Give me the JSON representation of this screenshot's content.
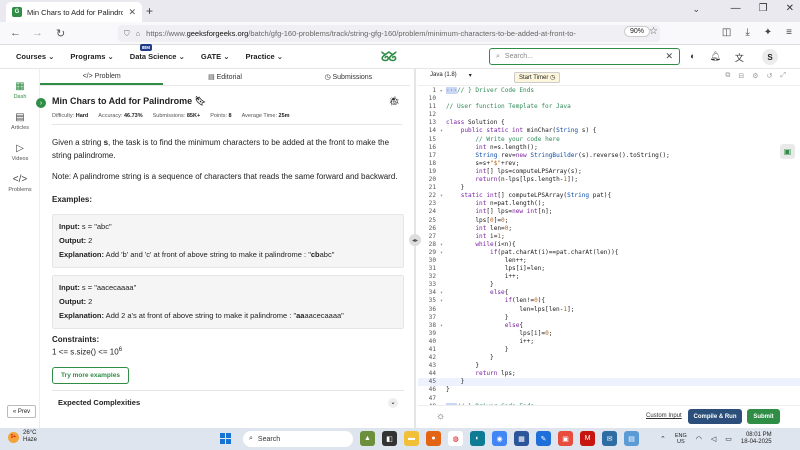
{
  "browser": {
    "tab_title": "Min Chars to Add for Palindron",
    "url_prefix": "https://www.",
    "url_host": "geeksforgeeks.org",
    "url_path": "/batch/gfg-160-problems/track/string-gfg-160/problem/minimum-characters-to-be-added-at-front-to-m",
    "zoom": "90%"
  },
  "header": {
    "menu": [
      {
        "label": "Courses"
      },
      {
        "label": "Programs"
      },
      {
        "label": "Data Science",
        "badge": "IBM"
      },
      {
        "label": "GATE"
      },
      {
        "label": "Practice"
      }
    ],
    "logo": "GG",
    "search_placeholder": "Search...",
    "avatar_letter": "S"
  },
  "rail": [
    {
      "label": "Dash",
      "icon": "dashboard-icon",
      "glyph": "▦",
      "active": true
    },
    {
      "label": "Articles",
      "icon": "articles-icon",
      "glyph": "▤",
      "active": false
    },
    {
      "label": "Videos",
      "icon": "videos-icon",
      "glyph": "▷",
      "active": false
    },
    {
      "label": "Problems",
      "icon": "code-icon",
      "glyph": "</>",
      "active": false
    }
  ],
  "prev_label": "« Prev",
  "problem_tabs": [
    {
      "label": "</> Problem",
      "active": true
    },
    {
      "label": "▤ Editorial",
      "active": false
    },
    {
      "label": "◷ Submissions",
      "active": false
    }
  ],
  "problem": {
    "title": "Min Chars to Add for Palindrome",
    "meta": [
      {
        "k": "Difficulty:",
        "v": "Hard"
      },
      {
        "k": "Accuracy:",
        "v": "46.73%"
      },
      {
        "k": "Submissions:",
        "v": "85K+"
      },
      {
        "k": "Points:",
        "v": "8"
      },
      {
        "k": "Average Time:",
        "v": "25m"
      }
    ],
    "desc_1": "Given a string ",
    "desc_s": "s",
    "desc_2": ", the task is to find the minimum characters to be added at the front to make the string palindrome.",
    "note": "Note: A palindrome string is a sequence of characters that reads the same forward and backward.",
    "examples_heading": "Examples:",
    "examples": [
      {
        "input": " s = \"abc\"",
        "output": " 2",
        "expl_pre": " Add 'b' and 'c' at front of above string to make it palindrome : \"",
        "expl_bold": "cb",
        "expl_post": "abc\""
      },
      {
        "input": " s = \"aacecaaaa\"",
        "output": " 2",
        "expl_pre": " Add 2 a's at front of above string to make it palindrome : \"",
        "expl_bold": "aa",
        "expl_post": "aacecaaaa\""
      }
    ],
    "input_label": "Input:",
    "output_label": "Output:",
    "expl_label": "Explanation:",
    "constraints_heading": "Constraints:",
    "constraint_base": "1 <= s.size() <= 10",
    "constraint_exp": "6",
    "more_examples": "Try more examples",
    "expected_complexities": "Expected Complexities"
  },
  "editor": {
    "language": "Java (1.8)",
    "timer": "Start Timer ◷",
    "lines": [
      {
        "n": "1",
        "g": "▸",
        "html": "<span class='fold'>···</span><span class='cm'>// } Driver Code Ends</span>"
      },
      {
        "n": "10",
        "g": "",
        "html": ""
      },
      {
        "n": "11",
        "g": "",
        "html": "<span class='cm'>// User function Template for Java</span>"
      },
      {
        "n": "12",
        "g": "",
        "html": ""
      },
      {
        "n": "13",
        "g": "",
        "html": "<span class='kw'>class</span> Solution {"
      },
      {
        "n": "14",
        "g": "▾",
        "html": "    <span class='kw'>public static int</span> minChar(<span class='ty'>String</span> s) {"
      },
      {
        "n": "15",
        "g": "",
        "html": "        <span class='cm'>// Write your code here</span>"
      },
      {
        "n": "16",
        "g": "",
        "html": "        <span class='kw'>int</span> n=s.length();"
      },
      {
        "n": "17",
        "g": "",
        "html": "        <span class='ty'>String</span> rev=<span class='kw'>new</span> <span class='ty'>StringBuilder</span>(s).reverse().toString();"
      },
      {
        "n": "18",
        "g": "",
        "html": "        s=s+<span class='num-c'>\"$\"</span>+rev;"
      },
      {
        "n": "19",
        "g": "",
        "html": "        <span class='kw'>int</span>[] lps=computeLPSArray(s);"
      },
      {
        "n": "20",
        "g": "",
        "html": "        <span class='kw'>return</span>(n-lps[lps.length-<span class='num-c'>1</span>]);"
      },
      {
        "n": "21",
        "g": "",
        "html": "    }"
      },
      {
        "n": "22",
        "g": "▾",
        "html": "    <span class='kw'>static int</span>[] computeLPSArray(<span class='ty'>String</span> pat){"
      },
      {
        "n": "23",
        "g": "",
        "html": "        <span class='kw'>int</span> n=pat.length();"
      },
      {
        "n": "24",
        "g": "",
        "html": "        <span class='kw'>int</span>[] lps=<span class='kw'>new int</span>[n];"
      },
      {
        "n": "25",
        "g": "",
        "html": "        lps[<span class='num-c'>0</span>]=<span class='num-c'>0</span>;"
      },
      {
        "n": "26",
        "g": "",
        "html": "        <span class='kw'>int</span> len=<span class='num-c'>0</span>;"
      },
      {
        "n": "27",
        "g": "",
        "html": "        <span class='kw'>int</span> i=<span class='num-c'>1</span>;"
      },
      {
        "n": "28",
        "g": "▾",
        "html": "        <span class='kw'>while</span>(i&lt;n){"
      },
      {
        "n": "29",
        "g": "▾",
        "html": "            <span class='kw'>if</span>(pat.charAt(i)==pat.charAt(len)){"
      },
      {
        "n": "30",
        "g": "",
        "html": "                len++;"
      },
      {
        "n": "31",
        "g": "",
        "html": "                lps[i]=len;"
      },
      {
        "n": "32",
        "g": "",
        "html": "                i++;"
      },
      {
        "n": "33",
        "g": "",
        "html": "            }"
      },
      {
        "n": "34",
        "g": "▾",
        "html": "            <span class='kw'>else</span>{"
      },
      {
        "n": "35",
        "g": "▾",
        "html": "                <span class='kw'>if</span>(len!=<span class='num-c'>0</span>){"
      },
      {
        "n": "36",
        "g": "",
        "html": "                    len=lps[len-<span class='num-c'>1</span>];"
      },
      {
        "n": "37",
        "g": "",
        "html": "                }"
      },
      {
        "n": "38",
        "g": "▾",
        "html": "                <span class='kw'>else</span>{"
      },
      {
        "n": "39",
        "g": "",
        "html": "                    lps[i]=<span class='num-c'>0</span>;"
      },
      {
        "n": "40",
        "g": "",
        "html": "                    i++;"
      },
      {
        "n": "41",
        "g": "",
        "html": "                }"
      },
      {
        "n": "42",
        "g": "",
        "html": "            }"
      },
      {
        "n": "43",
        "g": "",
        "html": "        }"
      },
      {
        "n": "44",
        "g": "",
        "html": "        <span class='kw'>return</span> lps;"
      },
      {
        "n": "45",
        "g": "",
        "html": "    }",
        "hl": true
      },
      {
        "n": "46",
        "g": "",
        "html": "}"
      },
      {
        "n": "47",
        "g": "",
        "html": ""
      },
      {
        "n": "48",
        "g": "▸",
        "html": "<span class='fold'>···</span><span class='cm'>// } Driver Code Ends</span>"
      }
    ],
    "custom_input": "Custom Input",
    "compile_run": "Compile & Run",
    "submit": "Submit"
  },
  "taskbar": {
    "temp": "26°C",
    "weather": "Haze",
    "search": "Search",
    "lang_top": "ENG",
    "lang_bottom": "US",
    "time": "08:01 PM",
    "date": "18-04-2025"
  }
}
